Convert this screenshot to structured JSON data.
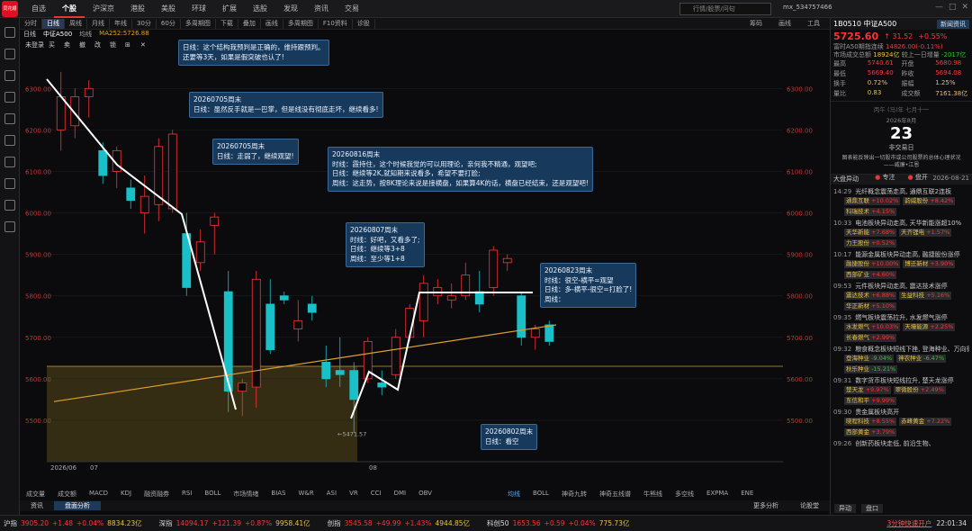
{
  "app": {
    "logo": "同花顺"
  },
  "nav": [
    "自选",
    "个股",
    "沪深京",
    "港股",
    "美股",
    "环球",
    "扩展",
    "选股",
    "发现",
    "资讯",
    "交易"
  ],
  "nav_active": 1,
  "search": {
    "placeholder": "行情/股票/问句"
  },
  "user": "mx_534757466",
  "toolbar": {
    "items": [
      "分时",
      "日线",
      "周线",
      "月线",
      "年线",
      "30分",
      "60分",
      "多周期图",
      "下载",
      "叠加",
      "画线",
      "多周期图",
      "F10资料",
      "诊股"
    ],
    "active": "日线",
    "right": [
      "筹码",
      "画线",
      "工具"
    ]
  },
  "legend": {
    "name": "日线",
    "code": "中证A500",
    "ma_label": "均线",
    "ma": "MA252:5726.88"
  },
  "chart_toolbar": [
    "未登录",
    "买",
    "卖",
    "撤",
    "改",
    "锁",
    "⊞",
    "✕"
  ],
  "chart_data": {
    "type": "candlestick",
    "title": "中证A500 周线",
    "y_ticks": [
      5500,
      5600,
      5700,
      5800,
      5900,
      6000,
      6100,
      6200,
      6300
    ],
    "x_ticks": [
      "2026/06",
      "07",
      "08"
    ],
    "low_label": "←5471.57",
    "candles": [
      {
        "o": 6200,
        "h": 6340,
        "l": 6150,
        "c": 6280
      },
      {
        "o": 6210,
        "h": 6300,
        "l": 6180,
        "c": 6280
      },
      {
        "o": 6280,
        "h": 6320,
        "l": 6230,
        "c": 6300
      },
      {
        "o": 6150,
        "h": 6170,
        "l": 6070,
        "c": 6090
      },
      {
        "o": 6100,
        "h": 6160,
        "l": 6060,
        "c": 6150
      },
      {
        "o": 6060,
        "h": 6080,
        "l": 6010,
        "c": 6030
      },
      {
        "o": 6000,
        "h": 6090,
        "l": 5950,
        "c": 6040
      },
      {
        "o": 6020,
        "h": 6180,
        "l": 5980,
        "c": 6160
      },
      {
        "o": 6010,
        "h": 6200,
        "l": 6000,
        "c": 6190
      },
      {
        "o": 5950,
        "h": 6000,
        "l": 5800,
        "c": 5820
      },
      {
        "o": 5880,
        "h": 5960,
        "l": 5860,
        "c": 5930
      },
      {
        "o": 5970,
        "h": 6000,
        "l": 5900,
        "c": 5990
      },
      {
        "o": 5810,
        "h": 5860,
        "l": 5520,
        "c": 5570
      },
      {
        "o": 5570,
        "h": 5600,
        "l": 5510,
        "c": 5590
      },
      {
        "o": 5580,
        "h": 5860,
        "l": 5530,
        "c": 5840
      },
      {
        "o": 5780,
        "h": 5840,
        "l": 5660,
        "c": 5670
      },
      {
        "o": 5800,
        "h": 5810,
        "l": 5780,
        "c": 5790
      },
      {
        "o": 5720,
        "h": 5790,
        "l": 5690,
        "c": 5740
      },
      {
        "o": 5780,
        "h": 5800,
        "l": 5740,
        "c": 5760
      },
      {
        "o": 5640,
        "h": 5680,
        "l": 5580,
        "c": 5600
      },
      {
        "o": 5620,
        "h": 5700,
        "l": 5580,
        "c": 5610
      },
      {
        "o": 5620,
        "h": 5640,
        "l": 5470,
        "c": 5550
      },
      {
        "o": 5600,
        "h": 5700,
        "l": 5590,
        "c": 5690
      },
      {
        "o": 5590,
        "h": 5620,
        "l": 5560,
        "c": 5580
      },
      {
        "o": 5610,
        "h": 5720,
        "l": 5600,
        "c": 5700
      },
      {
        "o": 5700,
        "h": 5780,
        "l": 5690,
        "c": 5770
      },
      {
        "o": 5740,
        "h": 5850,
        "l": 5700,
        "c": 5830
      },
      {
        "o": 5800,
        "h": 5840,
        "l": 5780,
        "c": 5820
      },
      {
        "o": 5790,
        "h": 5830,
        "l": 5770,
        "c": 5800
      },
      {
        "o": 5800,
        "h": 5880,
        "l": 5790,
        "c": 5850
      },
      {
        "o": 5810,
        "h": 5860,
        "l": 5760,
        "c": 5780
      },
      {
        "o": 5820,
        "h": 5920,
        "l": 5800,
        "c": 5910
      },
      {
        "o": 5880,
        "h": 5900,
        "l": 5860,
        "c": 5890
      },
      {
        "o": 5800,
        "h": 5810,
        "l": 5680,
        "c": 5700
      },
      {
        "o": 5700,
        "h": 5730,
        "l": 5670,
        "c": 5720
      },
      {
        "o": 5730,
        "h": 5740,
        "l": 5680,
        "c": 5690
      }
    ],
    "ma_line": [
      5545,
      5730
    ]
  },
  "annotations": [
    {
      "text": "日线：这个结构我预判是正确的，维持跟预判。\n还要等3天，如果是假突破也认了!"
    },
    {
      "text": "20260705周末\n日线：虽然反手就是一巴掌，但是线没有彻底走坏，继续看多!"
    },
    {
      "text": "20260705周末\n日线：走弱了，继续观望!"
    },
    {
      "text": "20260816周末\n时线：霞持住，这个时候我觉的可以用理论，亲何我不精通，观望吧;\n日线：继续等2K,就知期来说看多，希望不要打脸;\n周线：这走势，按8K理论来说是接横盘，如果算4K的话，横盘已经结束，还是观望吧!"
    },
    {
      "text": "20260807周末\n时线：好吧，又看多了;\n日线：继续等3+8\n周线：至少等1+8"
    },
    {
      "text": "20260823周末\n时线：很空-横平=观望\n日线：多-横平-很空=打脸了!\n周线："
    },
    {
      "text": "20260802周末\n日线：看空"
    }
  ],
  "indicators": [
    "成交量",
    "成交额",
    "MACD",
    "KDJ",
    "融资融券",
    "RSI",
    "BOLL",
    "市场情绪",
    "BIAS",
    "W&R",
    "ASI",
    "VR",
    "CCI",
    "DMI",
    "OBV"
  ],
  "indicators_right": [
    "均线",
    "BOLL",
    "神奇九转",
    "神奇五线谱",
    "牛熊线",
    "多空线",
    "EXPMA",
    "ENE"
  ],
  "bottom_tabs": [
    "资讯",
    "盘面分析"
  ],
  "bottom_tabs_right": [
    "更多分析",
    "论股堂"
  ],
  "quote": {
    "code": "1B0510",
    "name": "中证A500",
    "btn": "新闻资讯",
    "price": "5725.60",
    "change": "↑ 31.52",
    "pct": "+0.55%",
    "r1k": "富时A50期指连续",
    "r1v": "14826.00(-0.11%)",
    "r2k": "市场成交总额",
    "r2v": "18924亿",
    "r2k2": "较上一日增量",
    "r2v2": "-2017亿",
    "stats": [
      [
        "最高",
        "5740.61",
        "开盘",
        "5680.98"
      ],
      [
        "最低",
        "5669.40",
        "昨收",
        "5694.08"
      ],
      [
        "换手",
        "0.72%",
        "振幅",
        "1.25%"
      ],
      [
        "量比",
        "0.83",
        "成交额",
        "7161.38亿"
      ]
    ]
  },
  "calendar": {
    "top": "丙午 (马)年 七月十一",
    "month": "2026年8月",
    "day": "23",
    "note": "非交易日",
    "quote": "图表能反映出一切股市或公司股票的总体心理状况\n——威廉•江恩",
    "btn1": "专注",
    "btn2": "盘开"
  },
  "news_head": {
    "title": "大盘异动",
    "date": "2026-08-21"
  },
  "news": [
    {
      "t": "14:29",
      "h": "光纤概念震荡走高, 通鼎互联2连板",
      "c": [
        [
          "通鼎互联",
          "+10.02%"
        ],
        [
          "韵威股份",
          "+8.42%"
        ],
        [
          "科瑞技术",
          "+4.15%"
        ]
      ]
    },
    {
      "t": "10:33",
      "h": "电池板块异动走高, 天华新能涨超10%",
      "c": [
        [
          "天华新能",
          "+7.68%"
        ],
        [
          "天齐锂电",
          "+1.57%"
        ],
        [
          "力王股份",
          "+0.52%"
        ]
      ]
    },
    {
      "t": "10:17",
      "h": "能源金属板块异动走高, 融捷股份涨停",
      "c": [
        [
          "融捷股份",
          "+10.00%"
        ],
        [
          "博迁新材",
          "+3.90%"
        ],
        [
          "西部矿业",
          "+4.60%"
        ]
      ]
    },
    {
      "t": "09:53",
      "h": "元件板块异动走高, 震达技术涨停",
      "c": [
        [
          "震达技术",
          "+6.88%"
        ],
        [
          "生益科技",
          "+5.16%"
        ],
        [
          "华正新材",
          "+5.10%"
        ]
      ]
    },
    {
      "t": "09:35",
      "h": "燃气板块震荡拉升, 水发燃气涨停",
      "c": [
        [
          "水发燃气",
          "+10.03%"
        ],
        [
          "天壕能源",
          "+2.25%"
        ],
        [
          "长春燃气",
          "+2.99%"
        ]
      ]
    },
    {
      "t": "09:32",
      "h": "粮食概念板块短线下挫, 登海种业、万向德农",
      "c": [
        [
          "登海种业",
          "-9.04%"
        ],
        [
          "神农种业",
          "-6.47%"
        ],
        [
          "秋乐种业",
          "-15.21%"
        ]
      ]
    },
    {
      "t": "09:31",
      "h": "数字货币板块短线拉升, 楚天龙涨停",
      "c": [
        [
          "楚天龙",
          "+9.97%"
        ],
        [
          "翠微股份",
          "+2.49%"
        ],
        [
          "东信和平",
          "+9.99%"
        ]
      ]
    },
    {
      "t": "09:30",
      "h": "贵金属板块高开",
      "c": [
        [
          "晓程科技",
          "+8.55%"
        ],
        [
          "赤峰黄金",
          "+7.22%"
        ],
        [
          "西部黄金",
          "+3.79%"
        ]
      ]
    },
    {
      "t": "09:26",
      "h": "创新药板块走低, 前沿生物、",
      "c": []
    }
  ],
  "rp_foot": [
    "异动",
    "盘口"
  ],
  "status": [
    {
      "n": "沪指",
      "p": "3905.20",
      "c": "+1.48",
      "pct": "+0.04%",
      "v": "8834.23亿"
    },
    {
      "n": "深指",
      "p": "14094.17",
      "c": "+121.39",
      "pct": "+0.87%",
      "v": "9958.41亿"
    },
    {
      "n": "创指",
      "p": "3545.58",
      "c": "+49.99",
      "pct": "+1.43%",
      "v": "4944.85亿"
    },
    {
      "n": "科创50",
      "p": "1653.56",
      "c": "+0.59",
      "pct": "+0.04%",
      "v": "775.73亿"
    }
  ],
  "status_right": {
    "notice": "3分钟快速开户",
    "time": "22:01:34"
  },
  "colors": {
    "up": "#ff3333",
    "down": "#19c0c8",
    "ma": "#e0a030",
    "annot_bg": "#173a5c"
  }
}
